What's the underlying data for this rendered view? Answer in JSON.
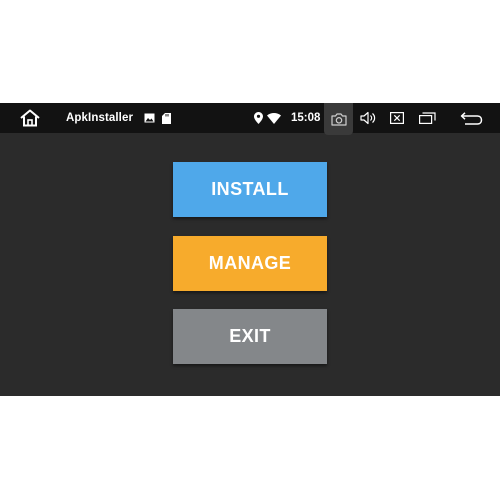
{
  "status_bar": {
    "app_title": "ApkInstaller",
    "time": "15:08",
    "icons": [
      "home-icon",
      "image-icon",
      "sd-card-icon",
      "location-icon",
      "wifi-icon",
      "camera-icon",
      "volume-icon",
      "close-box-icon",
      "recent-apps-icon",
      "back-icon"
    ]
  },
  "buttons": {
    "install_label": "INSTALL",
    "manage_label": "MANAGE",
    "exit_label": "EXIT"
  },
  "colors": {
    "install": "#4fa8ea",
    "manage": "#f7ab2c",
    "exit": "#84878a",
    "background": "#2b2b2b",
    "status_bar": "#121212"
  }
}
